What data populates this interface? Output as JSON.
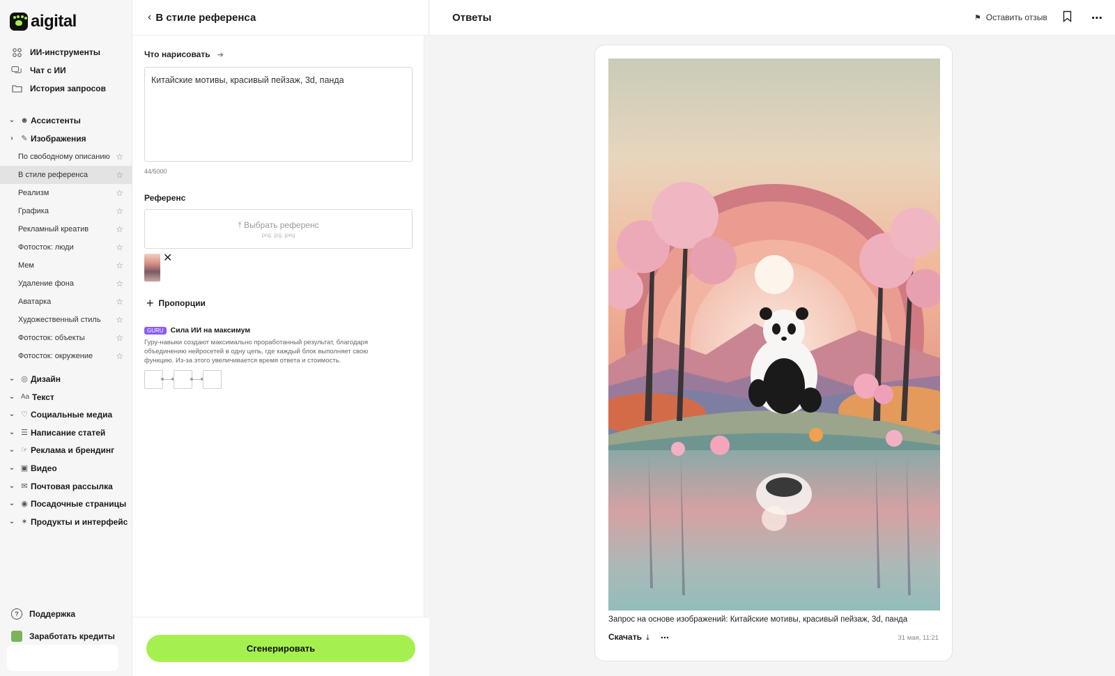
{
  "brand": {
    "logo_text": "aigital"
  },
  "sidebar": {
    "top_items": [
      {
        "label": "ИИ-инструменты",
        "icon": "grid-icon"
      },
      {
        "label": "Чат с ИИ",
        "icon": "chat-icon"
      },
      {
        "label": "История запросов",
        "icon": "folder-icon"
      }
    ],
    "sections": {
      "assistants": "Ассистенты",
      "images": "Изображения",
      "design": "Дизайн",
      "text": "Текст",
      "text_icon": "Aa",
      "social": "Социальные медиа",
      "articles": "Написание статей",
      "ads": "Реклама и брендинг",
      "video": "Видео",
      "mail": "Почтовая рассылка",
      "landing": "Посадочные страницы",
      "products": "Продукты и интерфейс"
    },
    "image_items": [
      "По свободному описанию",
      "В стиле референса",
      "Реализм",
      "Графика",
      "Рекламный креатив",
      "Фотосток: люди",
      "Мем",
      "Удаление фона",
      "Аватарка",
      "Художественный стиль",
      "Фотосток: объекты",
      "Фотосток: окружение"
    ],
    "active_item": "В стиле референса",
    "support": "Поддержка",
    "earn": "Заработать кредиты"
  },
  "form": {
    "title": "В стиле референса",
    "prompt_label": "Что нарисовать",
    "prompt_value": "Китайские мотивы, красивый пейзаж, 3d, панда",
    "counter": "44/5000",
    "reference_label": "Референс",
    "upload_label": "Выбрать референс",
    "upload_formats": "png, jpg, jpeg",
    "proportions": "Пропорции",
    "guru_badge": "GURU",
    "guru_title": "Сила ИИ на максимум",
    "guru_desc": "Гуру-навыки создают максимально проработанный результат, благодаря объединению нейросетей в одну цепь, где каждый блок выполняет свою функцию. Из-за этого увеличивается время ответа и стоимость.",
    "generate": "Сгенерировать"
  },
  "results": {
    "title": "Ответы",
    "feedback": "Оставить отзыв",
    "caption": "Запрос на основе изображений: Китайские мотивы, красивый пейзаж, 3d, панда",
    "download": "Скачать",
    "timestamp": "31 мая, 11:21"
  },
  "colors": {
    "accent": "#a5f04f",
    "guru": "#8b5cf6",
    "active_bg": "#e3e3e5"
  }
}
